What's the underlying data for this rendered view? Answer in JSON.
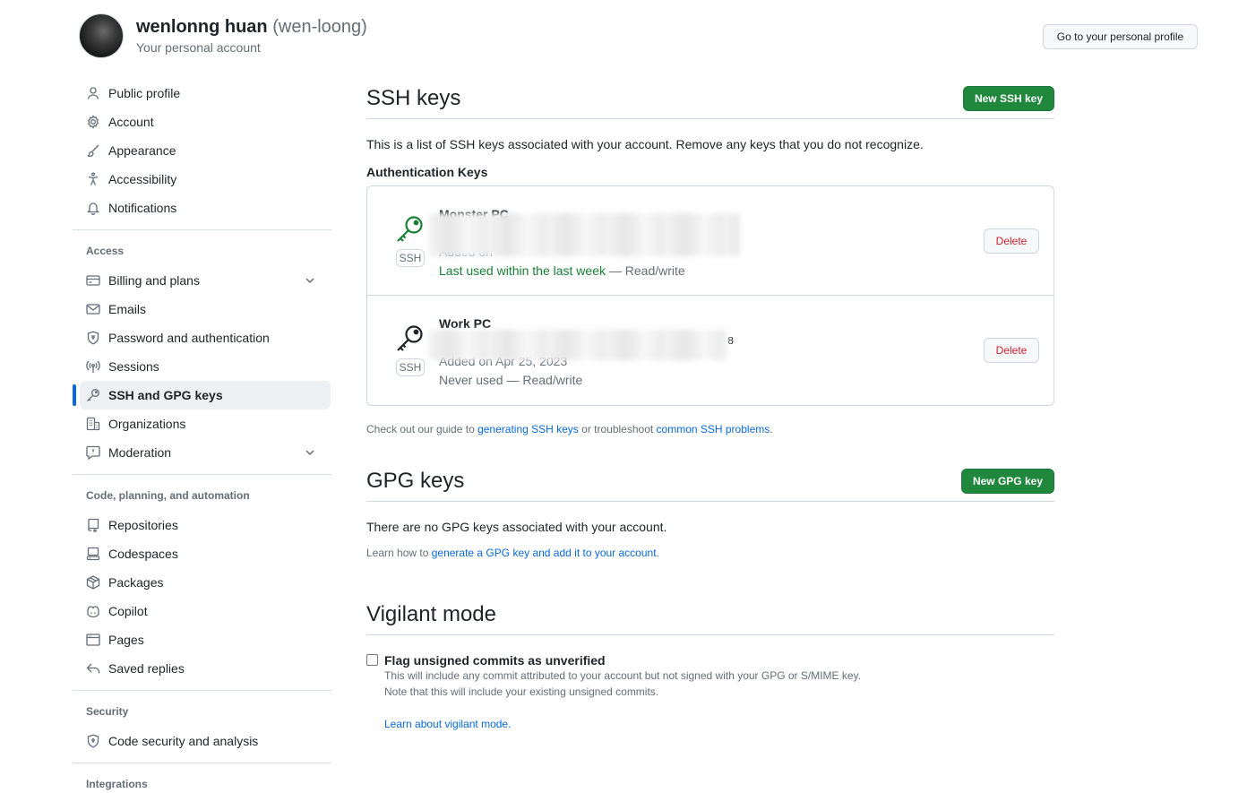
{
  "header": {
    "name": "wenlonng huan",
    "login": "(wen-loong)",
    "subtitle": "Your personal account",
    "profile_button": "Go to your personal profile"
  },
  "sidebar": {
    "items_top": [
      {
        "label": "Public profile",
        "icon": "person-icon"
      },
      {
        "label": "Account",
        "icon": "gear-icon"
      },
      {
        "label": "Appearance",
        "icon": "paintbrush-icon"
      },
      {
        "label": "Accessibility",
        "icon": "accessibility-icon"
      },
      {
        "label": "Notifications",
        "icon": "bell-icon"
      }
    ],
    "access_title": "Access",
    "access_items": [
      {
        "label": "Billing and plans",
        "icon": "credit-card-icon"
      },
      {
        "label": "Emails",
        "icon": "mail-icon"
      },
      {
        "label": "Password and authentication",
        "icon": "shield-lock-icon"
      },
      {
        "label": "Sessions",
        "icon": "broadcast-icon"
      },
      {
        "label": "SSH and GPG keys",
        "icon": "key-icon"
      },
      {
        "label": "Organizations",
        "icon": "organization-icon"
      },
      {
        "label": "Moderation",
        "icon": "report-icon"
      }
    ],
    "code_title": "Code, planning, and automation",
    "code_items": [
      {
        "label": "Repositories",
        "icon": "repo-icon"
      },
      {
        "label": "Codespaces",
        "icon": "codespaces-icon"
      },
      {
        "label": "Packages",
        "icon": "package-icon"
      },
      {
        "label": "Copilot",
        "icon": "copilot-icon"
      },
      {
        "label": "Pages",
        "icon": "browser-icon"
      },
      {
        "label": "Saved replies",
        "icon": "reply-icon"
      }
    ],
    "security_title": "Security",
    "security_items": [
      {
        "label": "Code security and analysis",
        "icon": "shield-lock-icon"
      }
    ],
    "integrations_title": "Integrations"
  },
  "ssh": {
    "title": "SSH keys",
    "new_button": "New SSH key",
    "intro": "This is a list of SSH keys associated with your account. Remove any keys that you do not recognize.",
    "auth_heading": "Authentication Keys",
    "keys": [
      {
        "title": "Monster PC",
        "fingerprint": "",
        "added": "Added on",
        "used_prefix": "Last used within the last week",
        "used_suffix": " — Read/write",
        "delete": "Delete",
        "icon_color": "#1a7f37"
      },
      {
        "title": "Work PC",
        "fingerprint": "8",
        "added": "Added on Apr 25, 2023",
        "used_prefix": "Never used",
        "used_suffix": " — Read/write",
        "delete": "Delete",
        "icon_color": "#1f2328"
      }
    ],
    "ssh_badge": "SSH",
    "guide_prefix": "Check out our guide to ",
    "guide_link1": "generating SSH keys",
    "guide_mid": " or troubleshoot ",
    "guide_link2": "common SSH problems",
    "guide_suffix": "."
  },
  "gpg": {
    "title": "GPG keys",
    "new_button": "New GPG key",
    "empty": "There are no GPG keys associated with your account.",
    "learn_prefix": "Learn how to ",
    "learn_link": "generate a GPG key and add it to your account",
    "learn_suffix": "."
  },
  "vigilant": {
    "title": "Vigilant mode",
    "checkbox_label": "Flag unsigned commits as unverified",
    "desc1": "This will include any commit attributed to your account but not signed with your GPG or S/MIME key.",
    "desc2": "Note that this will include your existing unsigned commits.",
    "learn_link": "Learn about vigilant mode."
  },
  "colors": {
    "primary_green": "#1f883d",
    "link_blue": "#0969da",
    "danger_red": "#cf222e",
    "active_indicator": "#0969da"
  }
}
